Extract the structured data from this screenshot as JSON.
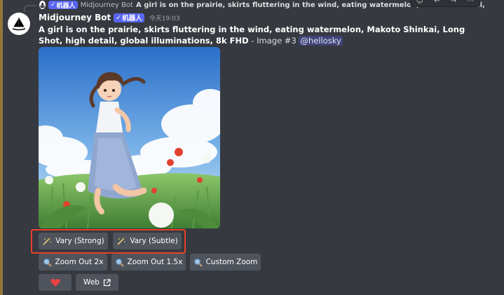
{
  "reply": {
    "author": "Midjourney Bot",
    "bot_tag": "机器人",
    "text": "A girl is on the prairie, skirts fluttering in the wind, eating watermelon, Makoto Shinkai, Long Shot, high d"
  },
  "message": {
    "author": "Midjourney Bot",
    "bot_tag": "机器人",
    "timestamp": "今天19:03",
    "prompt_bold": "A girl is on the prairie, skirts fluttering in the wind, eating watermelon, Makoto Shinkai, Long Shot, high detail, global illuminations, 8k FHD",
    "prompt_suffix": " - Image #3 ",
    "mention": "@hellosky"
  },
  "image": {
    "alt": "anime girl crouching in a flowery prairie"
  },
  "buttons": {
    "vary_strong": "Vary (Strong)",
    "vary_subtle": "Vary (Subtle)",
    "zoom_out_2x": "Zoom Out 2x",
    "zoom_out_15x": "Zoom Out 1.5x",
    "custom_zoom": "Custom Zoom",
    "web": "Web"
  },
  "colors": {
    "background": "#36393f",
    "button": "#4f545c",
    "bot_tag": "#5865f2",
    "highlight": "#e8412c",
    "heart": "#ed4245"
  }
}
